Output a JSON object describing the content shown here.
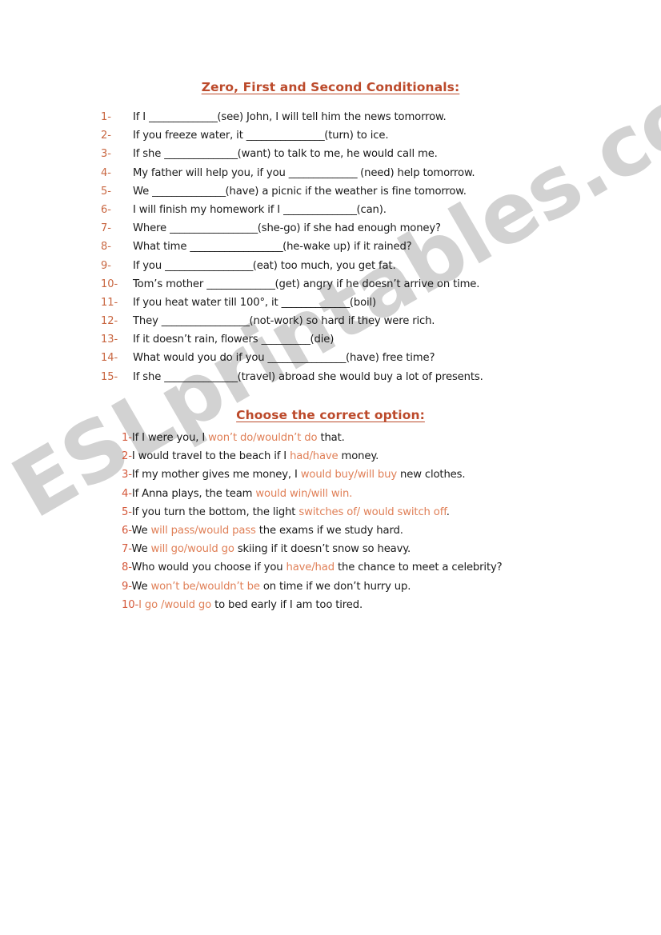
{
  "document": {
    "type": "esl-worksheet",
    "background_color": "#ffffff",
    "heading_color": "#bc4a2b",
    "number_color": "#c8653f",
    "option_color": "#e08058",
    "body_text_color": "#1a1a1a"
  },
  "watermark": {
    "text": "ESLprintables.com",
    "color": "#d2d2d2",
    "rotation_deg": -30
  },
  "section1": {
    "heading": "Zero, First and Second Conditionals:",
    "items": [
      {
        "num": "1-",
        "before": "If I ",
        "blank": "______________",
        "after": "(see) John, I will tell him the news tomorrow."
      },
      {
        "num": "2-",
        "before": "If you freeze water, it ",
        "blank": "________________",
        "after": "(turn) to ice."
      },
      {
        "num": "3-",
        "before": "If she ",
        "blank": "_______________",
        "after": "(want) to talk to me, he would call me."
      },
      {
        "num": "4-",
        "before": "My father will help you, if you ",
        "blank": "______________",
        "after": " (need) help tomorrow."
      },
      {
        "num": "5-",
        "before": "We ",
        "blank": "_______________",
        "after": "(have) a picnic if the weather is fine tomorrow."
      },
      {
        "num": "6-",
        "before": "I will finish my homework if I ",
        "blank": "_______________",
        "after": "(can)."
      },
      {
        "num": "7-",
        "before": "Where ",
        "blank": "__________________",
        "after": "(she-go) if she had enough money?"
      },
      {
        "num": "8-",
        "before": "What time ",
        "blank": "___________________",
        "after": "(he-wake up) if it rained?"
      },
      {
        "num": "9-",
        "before": "If you ",
        "blank": "__________________",
        "after": "(eat) too much, you get fat."
      },
      {
        "num": "10-",
        "before": "Tom’s mother ",
        "blank": "______________",
        "after": "(get) angry if he doesn’t arrive on time."
      },
      {
        "num": "11-",
        "before": "If you heat water till 100°, it ",
        "blank": "______________",
        "after": "(boil)"
      },
      {
        "num": "12-",
        "before": "They ",
        "blank": "__________________",
        "after": "(not-work) so hard if they were rich."
      },
      {
        "num": "13-",
        "before": "If it doesn’t rain, flowers ",
        "blank": "__________",
        "after": "(die)"
      },
      {
        "num": "14-",
        "before": "What would you do if you ",
        "blank": "________________",
        "after": "(have) free time?"
      },
      {
        "num": "15-",
        "before": "If she ",
        "blank": "_______________",
        "after": "(travel) abroad she would buy a lot of presents."
      }
    ]
  },
  "section2": {
    "heading": "Choose the correct option:",
    "items": [
      {
        "num": "1-",
        "before": "If I were you, I ",
        "option": "won’t do/wouldn’t do",
        "after": " that."
      },
      {
        "num": "2-",
        "before": "I would travel to the beach if I ",
        "option": "had/have",
        "after": " money."
      },
      {
        "num": "3-",
        "before": "If my mother gives me money, I ",
        "option": "would buy/will buy",
        "after": " new clothes."
      },
      {
        "num": "4-",
        "before": "If Anna plays, the team ",
        "option": "would win/will win.",
        "after": ""
      },
      {
        "num": "5-",
        "before": "If you turn the bottom, the light ",
        "option": "switches of/ would switch off",
        "after": "."
      },
      {
        "num": "6-",
        "before": "We ",
        "option": "will pass/would pass",
        "after": " the exams if we study hard."
      },
      {
        "num": "7-",
        "before": "We ",
        "option": "will go/would go",
        "after": " skiing if it doesn’t snow so heavy."
      },
      {
        "num": "8-",
        "before": "Who would you choose if you ",
        "option": "have/had",
        "after": " the chance to meet a celebrity?"
      },
      {
        "num": "9-",
        "before": "We ",
        "option": "won’t be/wouldn’t be",
        "after": " on time if we don’t hurry up."
      },
      {
        "num": "10-",
        "before": "",
        "option": "I go /would go",
        "after": " to bed early if I am too tired."
      }
    ]
  }
}
